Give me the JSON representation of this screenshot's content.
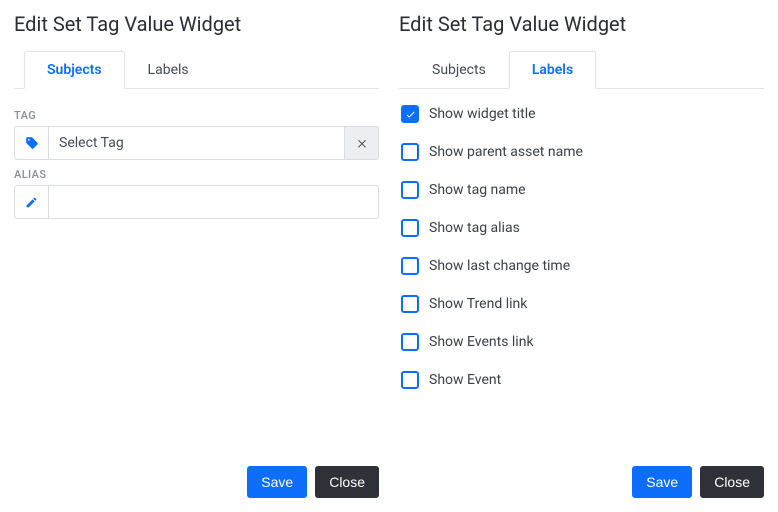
{
  "left": {
    "title": "Edit Set Tag Value Widget",
    "tabs": {
      "subjects": "Subjects",
      "labels": "Labels",
      "active": "subjects"
    },
    "fields": {
      "tag_label": "TAG",
      "tag_placeholder": "Select Tag",
      "alias_label": "ALIAS",
      "alias_value": ""
    },
    "actions": {
      "save": "Save",
      "close": "Close"
    }
  },
  "right": {
    "title": "Edit Set Tag Value Widget",
    "tabs": {
      "subjects": "Subjects",
      "labels": "Labels",
      "active": "labels"
    },
    "options": [
      {
        "key": "show_widget_title",
        "label": "Show widget title",
        "checked": true
      },
      {
        "key": "show_parent_asset",
        "label": "Show parent asset name",
        "checked": false
      },
      {
        "key": "show_tag_name",
        "label": "Show tag name",
        "checked": false
      },
      {
        "key": "show_tag_alias",
        "label": "Show tag alias",
        "checked": false
      },
      {
        "key": "show_last_change_time",
        "label": "Show last change time",
        "checked": false
      },
      {
        "key": "show_trend_link",
        "label": "Show Trend link",
        "checked": false
      },
      {
        "key": "show_events_link",
        "label": "Show Events link",
        "checked": false
      },
      {
        "key": "show_event",
        "label": "Show Event",
        "checked": false
      }
    ],
    "actions": {
      "save": "Save",
      "close": "Close"
    }
  }
}
